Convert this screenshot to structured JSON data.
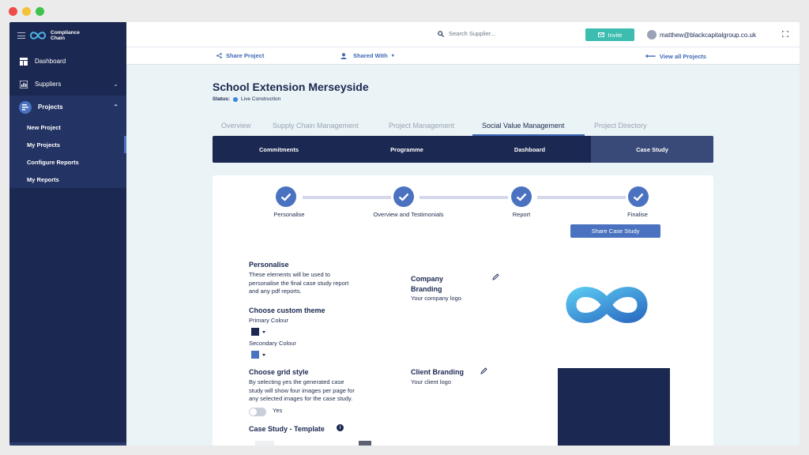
{
  "brand": {
    "name_line1": "Compliance",
    "name_line2": "Chain"
  },
  "colors": {
    "sidebar": "#1b2851",
    "accent": "#4a72c0",
    "invite": "#3dbdb0",
    "primary_swatch": "#1b2851",
    "secondary_swatch": "#4a72c0"
  },
  "sidebar": {
    "dashboard": "Dashboard",
    "suppliers": "Suppliers",
    "projects": "Projects",
    "sub_items": [
      "New Project",
      "My Projects",
      "Configure Reports",
      "My Reports"
    ]
  },
  "topbar": {
    "search_placeholder": "Search Supplier...",
    "invite_label": "Invite",
    "user_email": "matthew@blackcapitalgroup.co.uk"
  },
  "actions": {
    "share_project": "Share Project",
    "shared_with": "Shared With",
    "view_all": "View all Projects"
  },
  "project": {
    "title": "School Extension Merseyside",
    "status_label": "Status:",
    "status_value": "Live Construction"
  },
  "tabs": [
    "Overview",
    "Supply Chain Management",
    "Project Management",
    "Social Value Management",
    "Project Directory"
  ],
  "subtabs": [
    "Commitments",
    "Programme",
    "Dashboard",
    "Case Study"
  ],
  "steps": [
    "Personalise",
    "Overview and Testimonials",
    "Report",
    "Finalise"
  ],
  "share_case_study": "Share Case Study",
  "personalise": {
    "title": "Personalise",
    "line1": "These elements will be used to",
    "line2": "personalise the final case study report",
    "line3": "and any pdf reports."
  },
  "theme": {
    "title": "Choose custom theme",
    "primary": "Primary Colour",
    "secondary": "Secondary Colour"
  },
  "grid": {
    "title": "Choose grid style",
    "line1": "By selecting yes the generated case",
    "line2": "study will show four images per page for",
    "line3": "any selected images for the case study.",
    "toggle_label": "Yes"
  },
  "template_title": "Case Study - Template",
  "company_branding": {
    "title_line1": "Company",
    "title_line2": "Branding",
    "subtitle": "Your company logo"
  },
  "client_branding": {
    "title": "Client Branding",
    "subtitle": "Your client logo"
  }
}
